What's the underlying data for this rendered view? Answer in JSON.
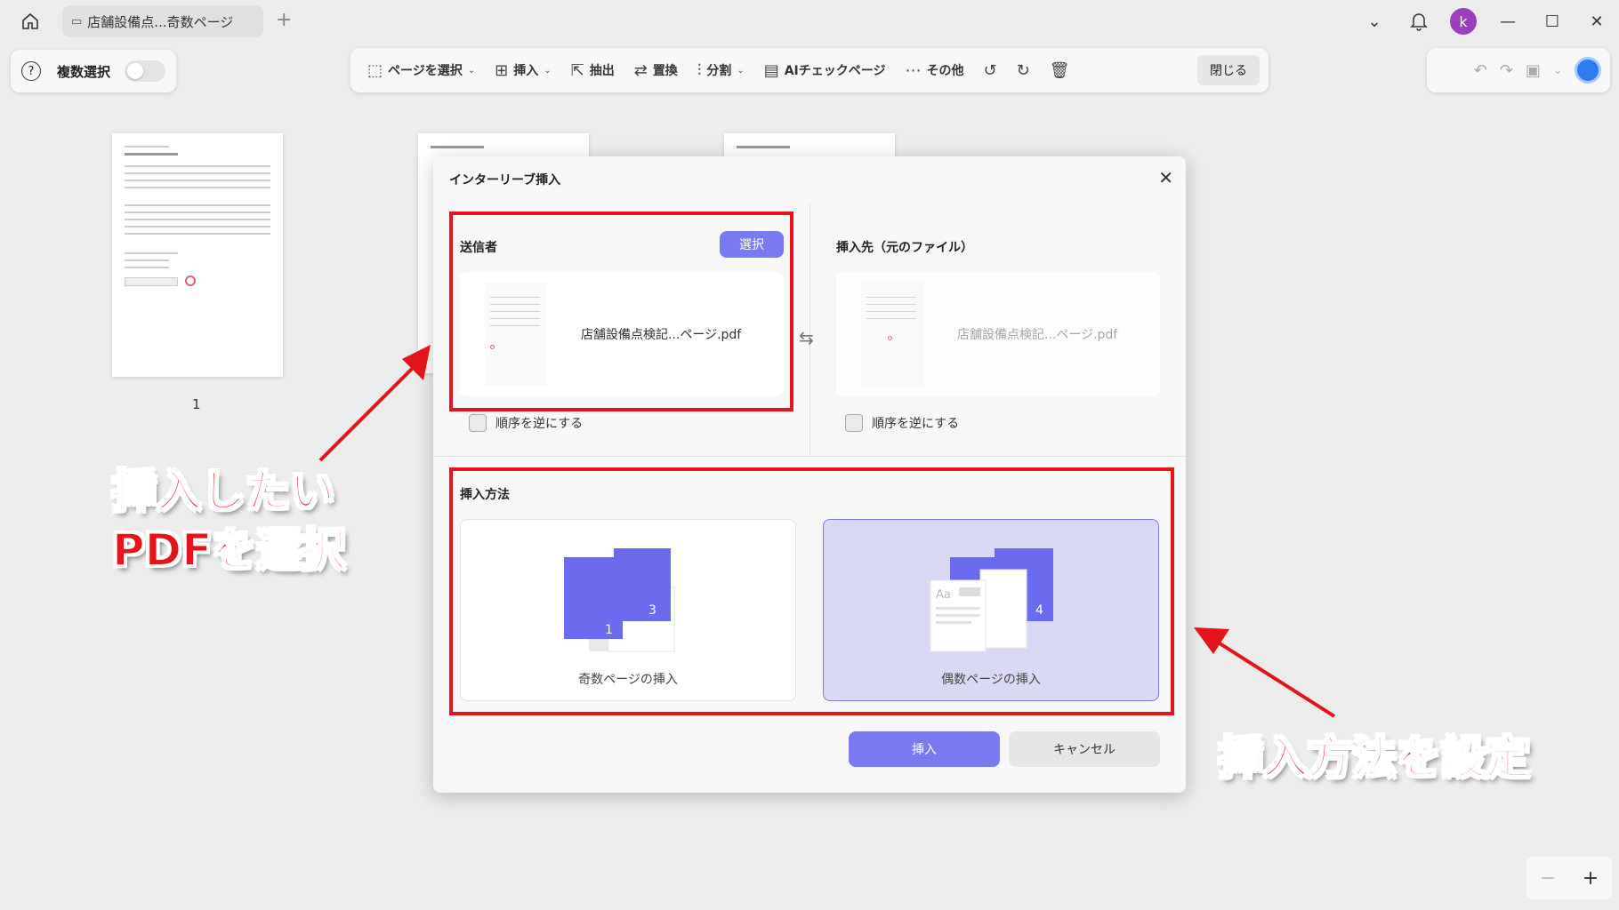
{
  "tab": {
    "title": "店舗設備点...奇数ページ"
  },
  "toolbar": {
    "multi_select_label": "複数選択",
    "items": [
      {
        "label": "ページを選択",
        "icon": "page-select-icon"
      },
      {
        "label": "挿入",
        "icon": "insert-icon"
      },
      {
        "label": "抽出",
        "icon": "extract-icon"
      },
      {
        "label": "置換",
        "icon": "replace-icon"
      },
      {
        "label": "分割",
        "icon": "split-icon"
      },
      {
        "label": "AIチェックページ",
        "icon": "ai-check-icon"
      },
      {
        "label": "その他",
        "icon": "more-icon"
      }
    ],
    "close_label": "閉じる"
  },
  "user": {
    "initial": "k",
    "color": "#9b3fbf"
  },
  "pages": {
    "page_1_number": "1"
  },
  "dialog": {
    "title": "インターリーブ挿入",
    "sender": {
      "title": "送信者",
      "select_label": "選択",
      "file_name": "店舗設備点検記...ページ.pdf",
      "reverse_label": "順序を逆にする"
    },
    "target": {
      "title": "挿入先（元のファイル）",
      "file_name": "店舗設備点検記...ページ.pdf",
      "reverse_label": "順序を逆にする"
    },
    "method": {
      "title": "挿入方法",
      "odd_label": "奇数ページの挿入",
      "even_label": "偶数ページの挿入",
      "selected": "even"
    },
    "insert_label": "挿入",
    "cancel_label": "キャンセル"
  },
  "annotations": {
    "left_line1": "挿入したい",
    "left_line2": "PDFを選択",
    "right": "挿入方法を設定"
  },
  "colors": {
    "accent": "#7a7af2",
    "annotation": "#e3151b",
    "selected_card": "#d9d9f6"
  }
}
